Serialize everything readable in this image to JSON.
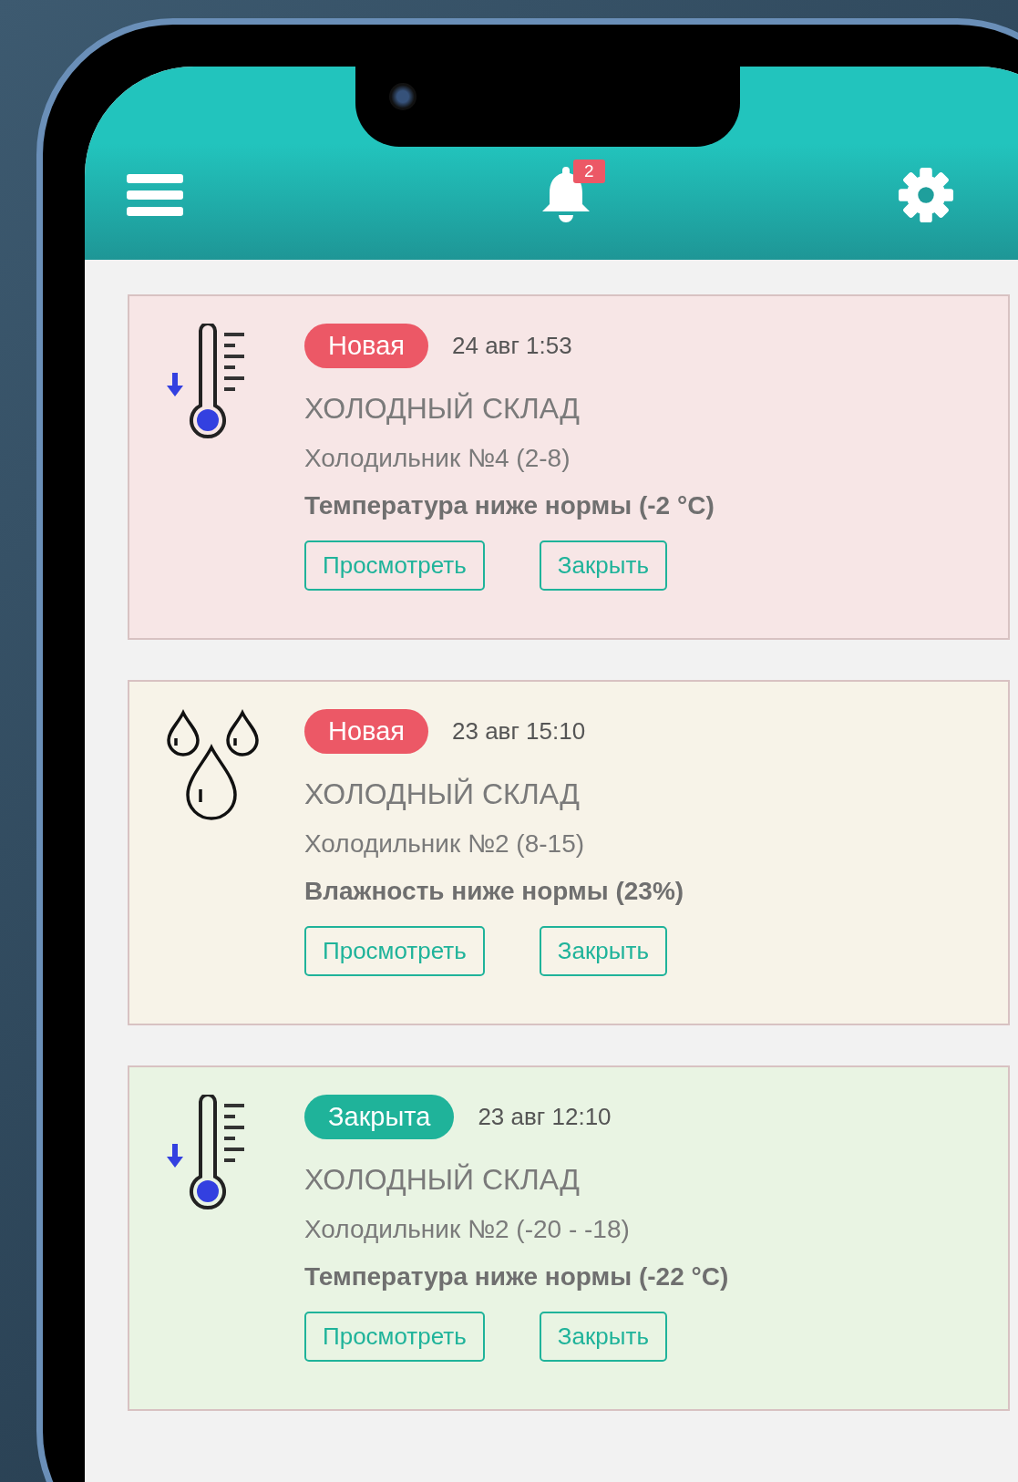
{
  "header": {
    "notification_count": "2"
  },
  "alerts": [
    {
      "kind": "temperature",
      "color": "#f7e6e6",
      "status": {
        "kind": "new",
        "label": "Новая"
      },
      "time": "24 авг 1:53",
      "place": "ХОЛОДНЫЙ СКЛАД",
      "device": "Холодильник №4 (2-8)",
      "message": "Температура ниже нормы (-2 °C)",
      "buttons": [
        "Просмотреть",
        "Закрыть"
      ]
    },
    {
      "kind": "humidity",
      "color": "#f7f3e8",
      "status": {
        "kind": "new",
        "label": "Новая"
      },
      "time": "23 авг 15:10",
      "place": "ХОЛОДНЫЙ СКЛАД",
      "device": "Холодильник №2 (8-15)",
      "message": "Влажность ниже нормы (23%)",
      "buttons": [
        "Просмотреть",
        "Закрыть"
      ]
    },
    {
      "kind": "temperature",
      "color": "#e9f4e3",
      "status": {
        "kind": "closed",
        "label": "Закрыта"
      },
      "time": "23 авг 12:10",
      "place": "ХОЛОДНЫЙ СКЛАД",
      "device": "Холодильник №2 (-20 - -18)",
      "message": "Температура ниже нормы (-22 °C)",
      "buttons": [
        "Просмотреть",
        "Закрыть"
      ]
    }
  ]
}
